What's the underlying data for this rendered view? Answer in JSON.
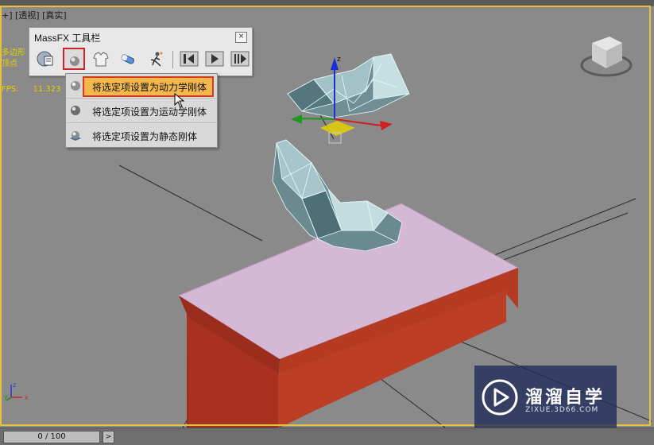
{
  "viewport": {
    "label": "+] [透视] [真实]",
    "stats": [
      "多边形",
      "顶点"
    ],
    "fps_label": "FPS:",
    "fps_value": "11.323"
  },
  "toolbar": {
    "title": "MassFX 工具栏",
    "close": "×",
    "buttons": [
      "world-parameters",
      "rigid-body",
      "cloth",
      "constraint",
      "ragdoll",
      "reset-simulation",
      "play-simulation",
      "step-simulation"
    ]
  },
  "menu": {
    "items": [
      {
        "label": "将选定项设置为动力学刚体",
        "highlighted": true
      },
      {
        "label": "将选定项设置为运动学刚体",
        "highlighted": false
      },
      {
        "label": "将选定项设置为静态刚体",
        "highlighted": false
      }
    ]
  },
  "statusbar": {
    "progress": "0 / 100",
    "next": ">"
  },
  "watermark": {
    "main": "溜溜自学",
    "sub": "ZIXUE.3D66.COM"
  },
  "colors": {
    "viewport_bg": "#8a8a8a",
    "active_border": "#e6c23a",
    "box_top": "#d5b7d6",
    "box_side": "#b43a22",
    "menu_highlight": "#f2b84c",
    "selection_red": "#d2232a"
  }
}
